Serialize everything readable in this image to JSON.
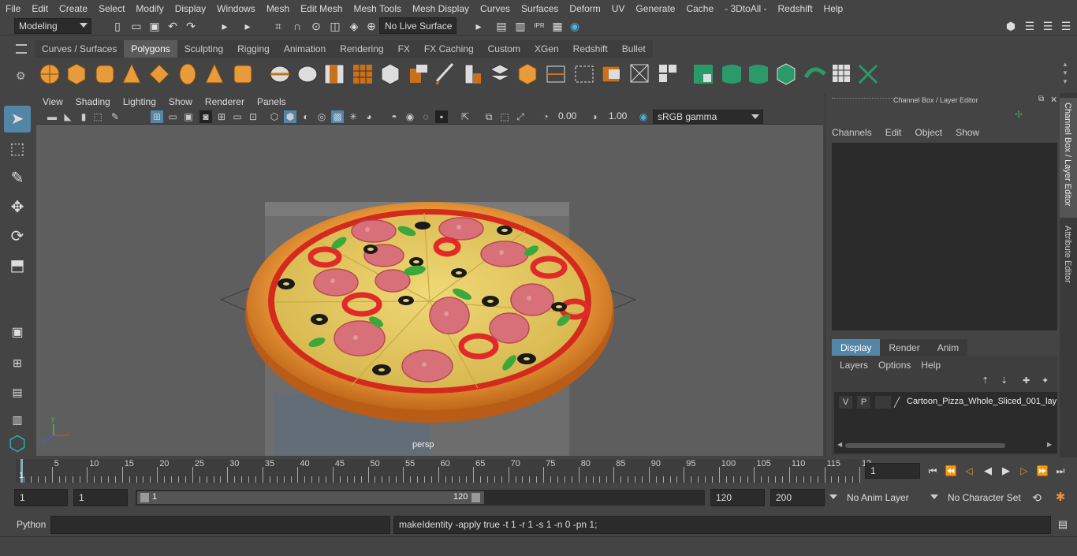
{
  "menubar": {
    "items": [
      "File",
      "Edit",
      "Create",
      "Select",
      "Modify",
      "Display",
      "Windows",
      "Mesh",
      "Edit Mesh",
      "Mesh Tools",
      "Mesh Display",
      "Curves",
      "Surfaces",
      "Deform",
      "UV",
      "Generate",
      "Cache",
      "- 3DtoAll -",
      "Redshift",
      "Help"
    ]
  },
  "statusline": {
    "mode": "Modeling",
    "live_surface": "No Live Surface"
  },
  "shelf": {
    "tabs": [
      "Curves / Surfaces",
      "Polygons",
      "Sculpting",
      "Rigging",
      "Animation",
      "Rendering",
      "FX",
      "FX Caching",
      "Custom",
      "XGen",
      "Redshift",
      "Bullet"
    ],
    "active_tab": "Polygons"
  },
  "viewport": {
    "menu": [
      "View",
      "Shading",
      "Lighting",
      "Show",
      "Renderer",
      "Panels"
    ],
    "exposure": "0.00",
    "gamma": "1.00",
    "color_space": "sRGB gamma",
    "camera_label": "persp",
    "axis_x": "x",
    "axis_y": "y",
    "axis_z": "z"
  },
  "channel_box": {
    "title": "Channel Box / Layer Editor",
    "menu": [
      "Channels",
      "Edit",
      "Object",
      "Show"
    ]
  },
  "layer_editor": {
    "tabs": [
      "Display",
      "Render",
      "Anim"
    ],
    "active_tab": "Display",
    "menu": [
      "Layers",
      "Options",
      "Help"
    ],
    "layer": {
      "visible": "V",
      "playback": "P",
      "name": "Cartoon_Pizza_Whole_Sliced_001_lay"
    }
  },
  "side_tabs": [
    "Channel Box / Layer Editor",
    "Attribute Editor"
  ],
  "timeline": {
    "ticks": [
      "5",
      "10",
      "15",
      "20",
      "25",
      "30",
      "35",
      "40",
      "45",
      "50",
      "55",
      "60",
      "65",
      "70",
      "75",
      "80",
      "85",
      "90",
      "95",
      "100",
      "105",
      "110",
      "115",
      "12"
    ],
    "start_label": "1",
    "current_frame": "1"
  },
  "range": {
    "start": "1",
    "playback_start": "1",
    "slider_start": "1",
    "slider_end": "120",
    "playback_end": "120",
    "end": "200",
    "anim_layer": "No Anim Layer",
    "character_set": "No Character Set"
  },
  "command": {
    "language": "Python",
    "result": "makeIdentity -apply true -t 1 -r 1 -s 1 -n 0 -pn 1;"
  },
  "colors": {
    "accent": "#5285a6",
    "crust": "#e08a2c",
    "sauce": "#d42a1e",
    "cheese": "#e8d06a",
    "salami": "#d8707a",
    "olive": "#1a1a1a",
    "basil": "#3aa83a"
  }
}
